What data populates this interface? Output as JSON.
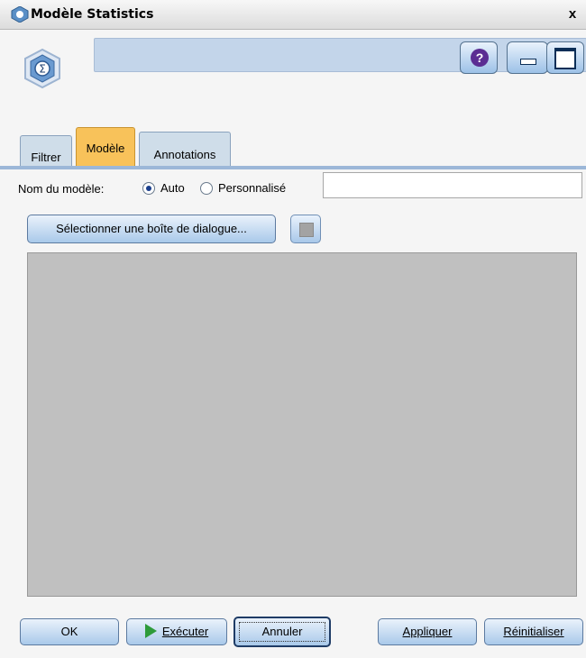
{
  "window": {
    "title": "Modèle Statistics",
    "close_glyph": "x"
  },
  "header": {
    "node_icon": "sigma-node-icon",
    "help_glyph": "?"
  },
  "tabs": [
    {
      "label": "Filtrer"
    },
    {
      "label": "Modèle",
      "active": true
    },
    {
      "label": "Annotations"
    }
  ],
  "model_name": {
    "label": "Nom du modèle:",
    "options": [
      "Auto",
      "Personnalisé"
    ],
    "selected": "Auto",
    "value": ""
  },
  "dialog_button": {
    "label": "Sélectionner une boîte de dialogue..."
  },
  "footer": {
    "ok": "OK",
    "execute": "Exécuter",
    "cancel": "Annuler",
    "apply": "Appliquer",
    "reset": "Réinitialiser"
  },
  "colors": {
    "active_tab": "#f8c25a",
    "button": "#a9c9ea",
    "canvas": "#c0c0c0"
  }
}
